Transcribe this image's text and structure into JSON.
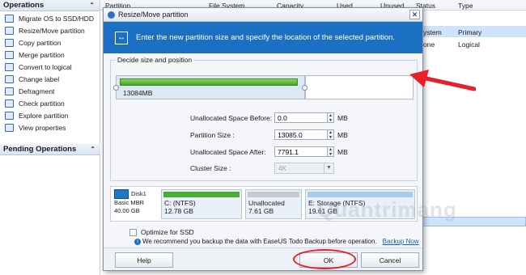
{
  "sidebar": {
    "operations_title": "Operations",
    "items": [
      {
        "label": "Migrate OS to SSD/HDD"
      },
      {
        "label": "Resize/Move partition"
      },
      {
        "label": "Copy partition"
      },
      {
        "label": "Merge partition"
      },
      {
        "label": "Convert to logical"
      },
      {
        "label": "Change label"
      },
      {
        "label": "Defragment"
      },
      {
        "label": "Check partition"
      },
      {
        "label": "Explore partition"
      },
      {
        "label": "View properties"
      }
    ],
    "pending_title": "Pending Operations"
  },
  "table": {
    "columns": [
      "Partition",
      "File System",
      "Capacity",
      "Used",
      "Unused",
      "Status",
      "Type"
    ],
    "rows": [
      {
        "status": "ystem",
        "type": "Primary"
      },
      {
        "status": "one",
        "type": "Logical"
      }
    ]
  },
  "dialog": {
    "title": "Resize/Move partition",
    "banner_text": "Enter the new partition size and specify the location of the selected partition.",
    "group_label": "Decide size and position",
    "partition_size_label": "13084MB",
    "fields": {
      "before_label": "Unallocated Space Before:",
      "before_value": "0.0",
      "size_label": "Partition Size :",
      "size_value": "13085.0",
      "after_label": "Unallocated Space After:",
      "after_value": "7791.1",
      "cluster_label": "Cluster Size :",
      "cluster_value": "4K",
      "unit": "MB"
    },
    "disk": {
      "name": "Disk1",
      "type": "Basic MBR",
      "size": "40.00 GB",
      "partitions": [
        {
          "name": "C: (NTFS)",
          "size": "12.78 GB",
          "bar_color": "#49ae34"
        },
        {
          "name": "Unallocated",
          "size": "7.61 GB",
          "bar_color": "#c6c9cd"
        },
        {
          "name": "E: Storage (NTFS)",
          "size": "19.61 GB",
          "bar_color": "#a9cbf0"
        }
      ]
    },
    "optimize_label": "Optimize for SSD",
    "info_text": "We recommend you backup the data with EaseUS Todo Backup before operation.",
    "backup_link": "Backup Now",
    "help_label": "Help",
    "ok_label": "OK",
    "cancel_label": "Cancel"
  },
  "watermark": "Quantrimang",
  "colors": {
    "banner": "#1b70c4",
    "annotation": "#e8202a"
  }
}
